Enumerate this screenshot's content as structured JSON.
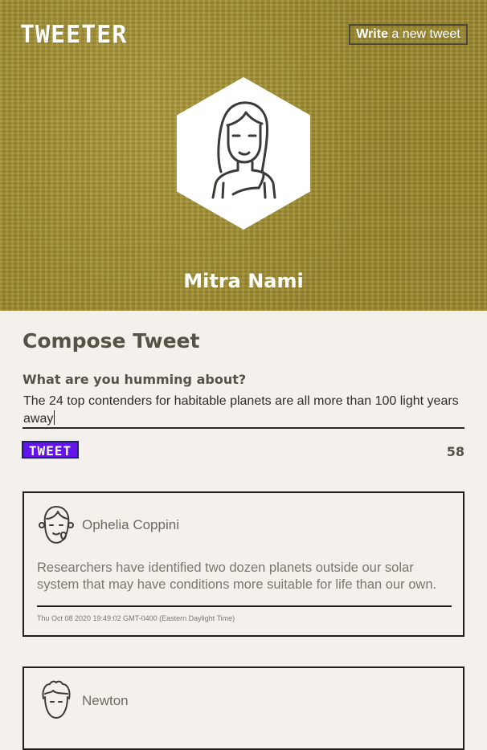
{
  "header": {
    "brand": "TWEETER",
    "write_bold": "Write",
    "write_rest": " a new tweet",
    "user_name": "Mitra Nami",
    "avatar_icon": "woman-avatar-icon"
  },
  "colors": {
    "header_bg": "#9d8c31",
    "page_bg": "#f4f1ec",
    "tweet_button": "#6413ea"
  },
  "compose": {
    "title": "Compose Tweet",
    "label": "What are you humming about?",
    "value": "The 24 top contenders for habitable planets are all more than 100 light years away",
    "button_label": "TWEET",
    "char_counter": "58"
  },
  "tweets": [
    {
      "author": "Ophelia Coppini",
      "avatar_icon": "girl-avatar-icon",
      "text": "Researchers have identified two dozen planets outside our solar system that may have conditions more suitable for life than our own.",
      "timestamp": "Thu Oct 08 2020 19:49:02 GMT-0400 (Eastern Daylight Time)"
    },
    {
      "author": "Newton",
      "avatar_icon": "man-avatar-icon"
    }
  ]
}
